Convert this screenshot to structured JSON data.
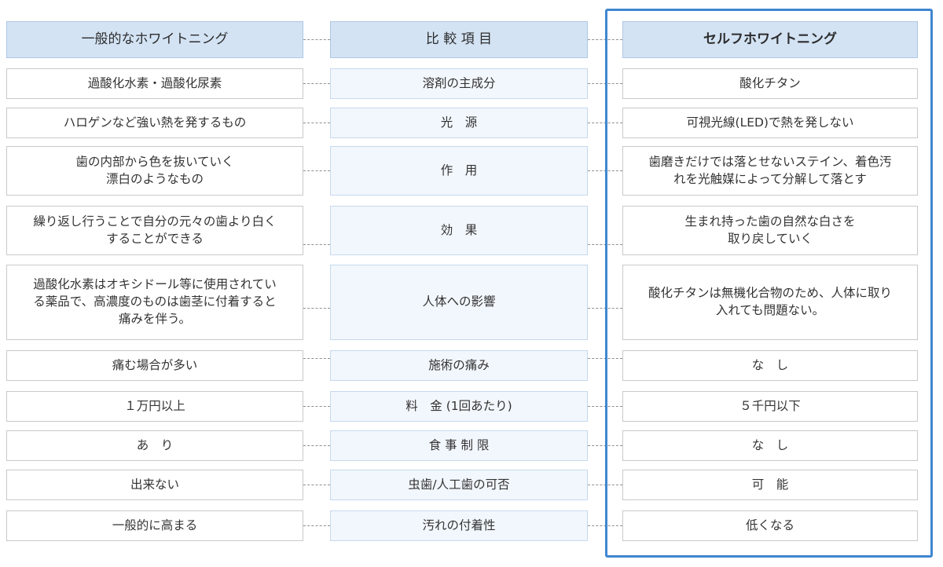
{
  "header": {
    "left": "一般的なホワイトニング",
    "middle": "比 較 項 目",
    "right": "セルフホワイトニング"
  },
  "rows": [
    {
      "left": "過酸化水素・過酸化尿素",
      "middle": "溶剤の主成分",
      "right": "酸化チタン"
    },
    {
      "left": "ハロゲンなど強い熱を発するもの",
      "middle": "光　源",
      "right": "可視光線(LED)で熱を発しない"
    },
    {
      "left": "歯の内部から色を抜いていく\n漂白のようなもの",
      "middle": "作　用",
      "right": "歯磨きだけでは落とせないステイン、着色汚\nれを光触媒によって分解して落とす"
    },
    {
      "left": "繰り返し行うことで自分の元々の歯より白く\nすることができる",
      "middle": "効　果",
      "right": "生まれ持った歯の自然な白さを\n取り戻していく"
    },
    {
      "left": "過酸化水素はオキシドール等に使用されてい\nる薬品で、高濃度のものは歯茎に付着すると\n痛みを伴う。",
      "middle": "人体への影響",
      "right": "酸化チタンは無機化合物のため、人体に取り\n入れても問題ない。"
    },
    {
      "left": "痛む場合が多い",
      "middle": "施術の痛み",
      "right": "な　し"
    },
    {
      "left": "１万円以上",
      "middle": "料　金 (1回あたり)",
      "right": "５千円以下"
    },
    {
      "left": "あ　り",
      "middle": "食 事 制 限",
      "right": "な　し"
    },
    {
      "left": "出来ない",
      "middle": "虫歯/人工歯の可否",
      "right": "可　能"
    },
    {
      "left": "一般的に高まる",
      "middle": "汚れの付着性",
      "right": "低くなる"
    }
  ]
}
